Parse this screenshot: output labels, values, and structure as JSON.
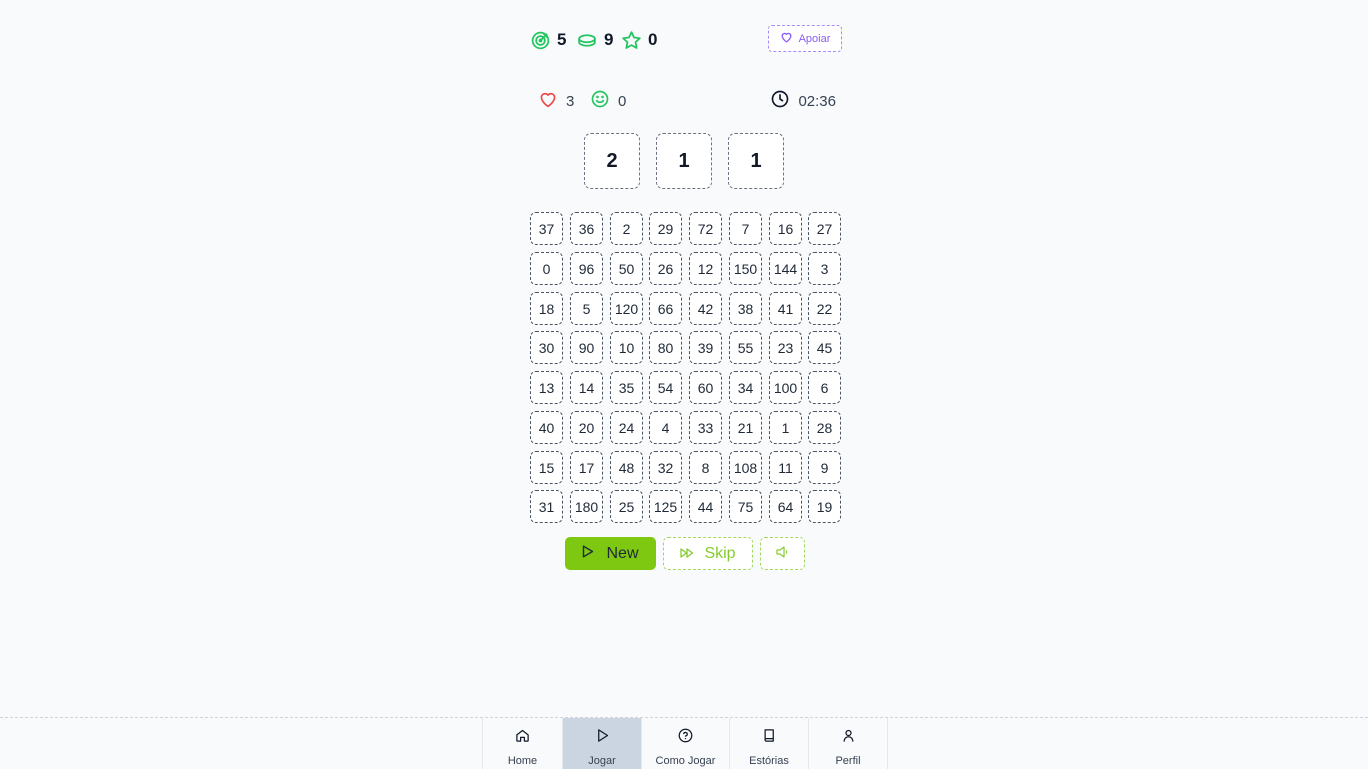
{
  "top_stats": {
    "targets": "5",
    "coins": "9",
    "stars": "0",
    "support_label": "Apoiar"
  },
  "status": {
    "lives": "3",
    "smiles": "0",
    "timer": "02:36"
  },
  "target_numbers": [
    "2",
    "1",
    "1"
  ],
  "grid": [
    [
      "37",
      "36",
      "2",
      "29",
      "72",
      "7",
      "16",
      "27"
    ],
    [
      "0",
      "96",
      "50",
      "26",
      "12",
      "150",
      "144",
      "3"
    ],
    [
      "18",
      "5",
      "120",
      "66",
      "42",
      "38",
      "41",
      "22"
    ],
    [
      "30",
      "90",
      "10",
      "80",
      "39",
      "55",
      "23",
      "45"
    ],
    [
      "13",
      "14",
      "35",
      "54",
      "60",
      "34",
      "100",
      "6"
    ],
    [
      "40",
      "20",
      "24",
      "4",
      "33",
      "21",
      "1",
      "28"
    ],
    [
      "15",
      "17",
      "48",
      "32",
      "8",
      "108",
      "11",
      "9"
    ],
    [
      "31",
      "180",
      "25",
      "125",
      "44",
      "75",
      "64",
      "19"
    ]
  ],
  "actions": {
    "new_label": "New",
    "skip_label": "Skip"
  },
  "nav": {
    "items": [
      {
        "label": "Home",
        "icon": "home-icon"
      },
      {
        "label": "Jogar",
        "icon": "play-icon"
      },
      {
        "label": "Como Jogar",
        "icon": "help-circle-icon"
      },
      {
        "label": "Estórias",
        "icon": "book-icon"
      },
      {
        "label": "Perfil",
        "icon": "user-icon"
      }
    ],
    "active_index": 1
  },
  "colors": {
    "accent_green": "#7ec811",
    "support_purple": "#8b5cf6",
    "heart_red": "#ef4444",
    "stat_green": "#22c55e"
  }
}
